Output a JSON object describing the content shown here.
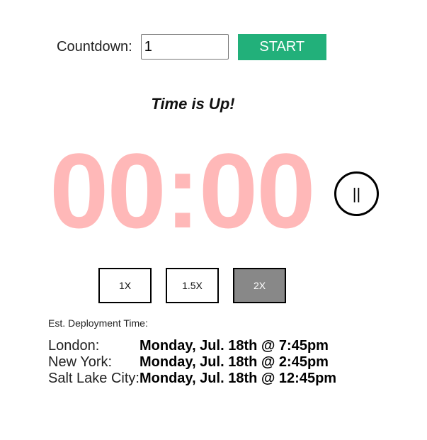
{
  "countdown": {
    "label": "Countdown:",
    "input_value": "1",
    "start_label": "START"
  },
  "status": {
    "message": "Time is Up!"
  },
  "timer": {
    "display": "00:00",
    "color": "#ffb8b8",
    "pause_label": "||"
  },
  "speed": {
    "options": [
      {
        "label": "1X",
        "active": false
      },
      {
        "label": "1.5X",
        "active": false
      },
      {
        "label": "2X",
        "active": true
      }
    ]
  },
  "deployment": {
    "heading": "Est. Deployment Time:",
    "rows": [
      {
        "city": "London:",
        "time": "Monday, Jul. 18th @ 7:45pm"
      },
      {
        "city": "New York:",
        "time": "Monday, Jul. 18th @ 2:45pm"
      },
      {
        "city": "Salt Lake City:",
        "time": "Monday, Jul. 18th @ 12:45pm"
      }
    ]
  },
  "colors": {
    "start_button": "#22b07a",
    "active_speed": "#888888"
  }
}
